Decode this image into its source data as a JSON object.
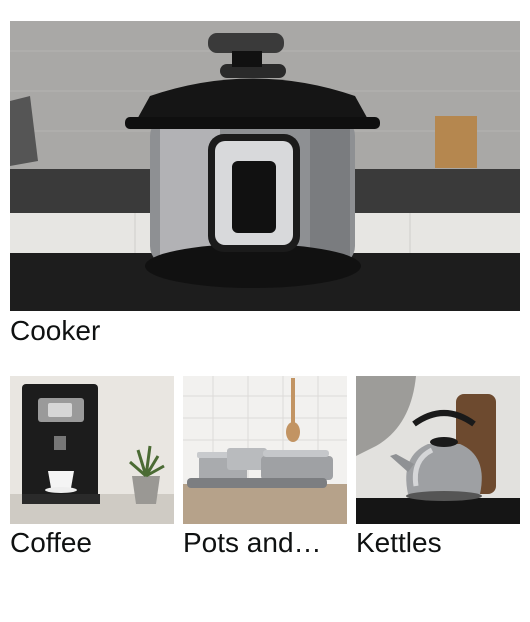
{
  "main": {
    "feature": {
      "label": "Cooker",
      "image": "pressure-cooker-photo"
    },
    "tiles": [
      {
        "label": "Coffee",
        "image": "coffee-machine-photo"
      },
      {
        "label": "Pots and…",
        "image": "cookware-set-photo"
      },
      {
        "label": "Kettles",
        "image": "stovetop-kettle-photo"
      }
    ]
  }
}
